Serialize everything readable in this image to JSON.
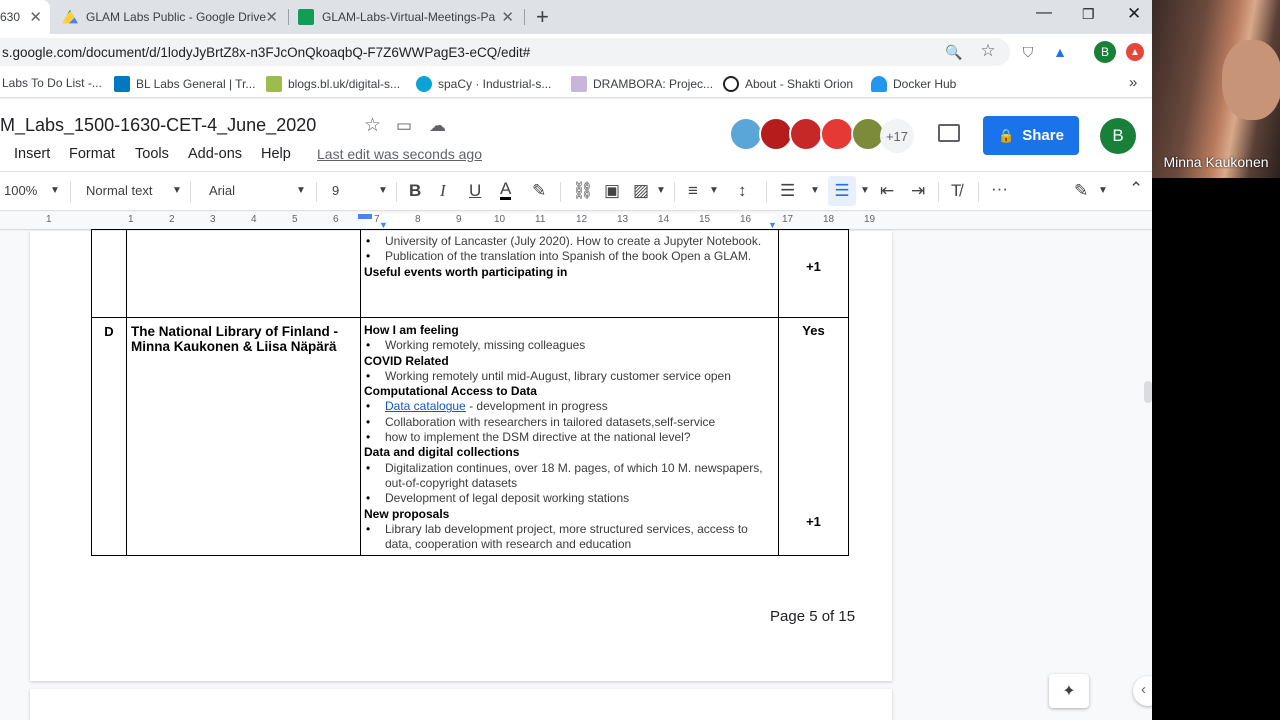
{
  "browser": {
    "tabs": [
      {
        "title": "630",
        "active": true
      },
      {
        "title": "GLAM Labs Public - Google Drive",
        "active": false
      },
      {
        "title": "GLAM-Labs-Virtual-Meetings-Pa",
        "active": false
      }
    ],
    "new_tab": "+",
    "url": "s.google.com/document/d/1lodyJyBrtZ8x-n3FJcOnQkoaqbQ-F7Z6WWPagE3-eCQ/edit#",
    "profile_initial": "B",
    "bookmarks": [
      "Labs To Do List -...",
      "BL Labs General | Tr...",
      "blogs.bl.uk/digital-s...",
      "spaCy · Industrial-s...",
      "DRAMBORA: Projec...",
      "About - Shakti Orion",
      "Docker Hub"
    ],
    "bookmarks_more": "»"
  },
  "docs": {
    "title": "M_Labs_1500-1630-CET-4_June_2020",
    "menus": [
      "Insert",
      "Format",
      "Tools",
      "Add-ons",
      "Help"
    ],
    "last_edit": "Last edit was seconds ago",
    "collaborators_more": "+17",
    "share_label": "Share",
    "account_initial": "B"
  },
  "toolbar": {
    "zoom": "100%",
    "style": "Normal text",
    "font": "Arial",
    "size": "9",
    "more": "···"
  },
  "ruler_numbers": [
    "1",
    "1",
    "2",
    "3",
    "4",
    "5",
    "6",
    "7",
    "8",
    "9",
    "10",
    "11",
    "12",
    "13",
    "14",
    "15",
    "16",
    "17",
    "18",
    "19"
  ],
  "table": {
    "row_prev": {
      "items": [
        "University of Lancaster (July 2020). How to create a Jupyter Notebook.",
        "Publication of the translation into Spanish of the book Open a GLAM."
      ],
      "heading_useful": "Useful events worth participating in",
      "vote": "+1"
    },
    "row_d": {
      "letter": "D",
      "org": "The National Library of Finland - Minna Kaukonen & Liisa Näpärä",
      "yes": "Yes",
      "vote": "+1",
      "h_feeling": "How I am feeling",
      "feeling_items": [
        "Working remotely, missing colleagues"
      ],
      "h_covid": "COVID Related",
      "covid_items": [
        "Working remotely until mid-August, library customer service open"
      ],
      "h_access": "Computational Access to Data",
      "access_link": "Data catalogue",
      "access_link_rest": " - development in progress",
      "access_items": [
        "Collaboration with researchers in tailored datasets,self-service",
        "how to implement the DSM directive at the national level?"
      ],
      "h_data": "Data and digital collections",
      "data_items": [
        "Digitalization continues, over 18 M. pages, of which 10 M. newspapers, out-of-copyright datasets",
        "Development of legal deposit working stations"
      ],
      "h_new": "New proposals",
      "new_items": [
        "Library lab development project, more structured services, access to data, cooperation with research and education"
      ]
    }
  },
  "page_indicator": "Page 5 of 15",
  "video": {
    "participant": "Minna Kaukonen"
  },
  "colors": {
    "share": "#1a73e8",
    "account": "#188038",
    "link": "#1155cc"
  }
}
